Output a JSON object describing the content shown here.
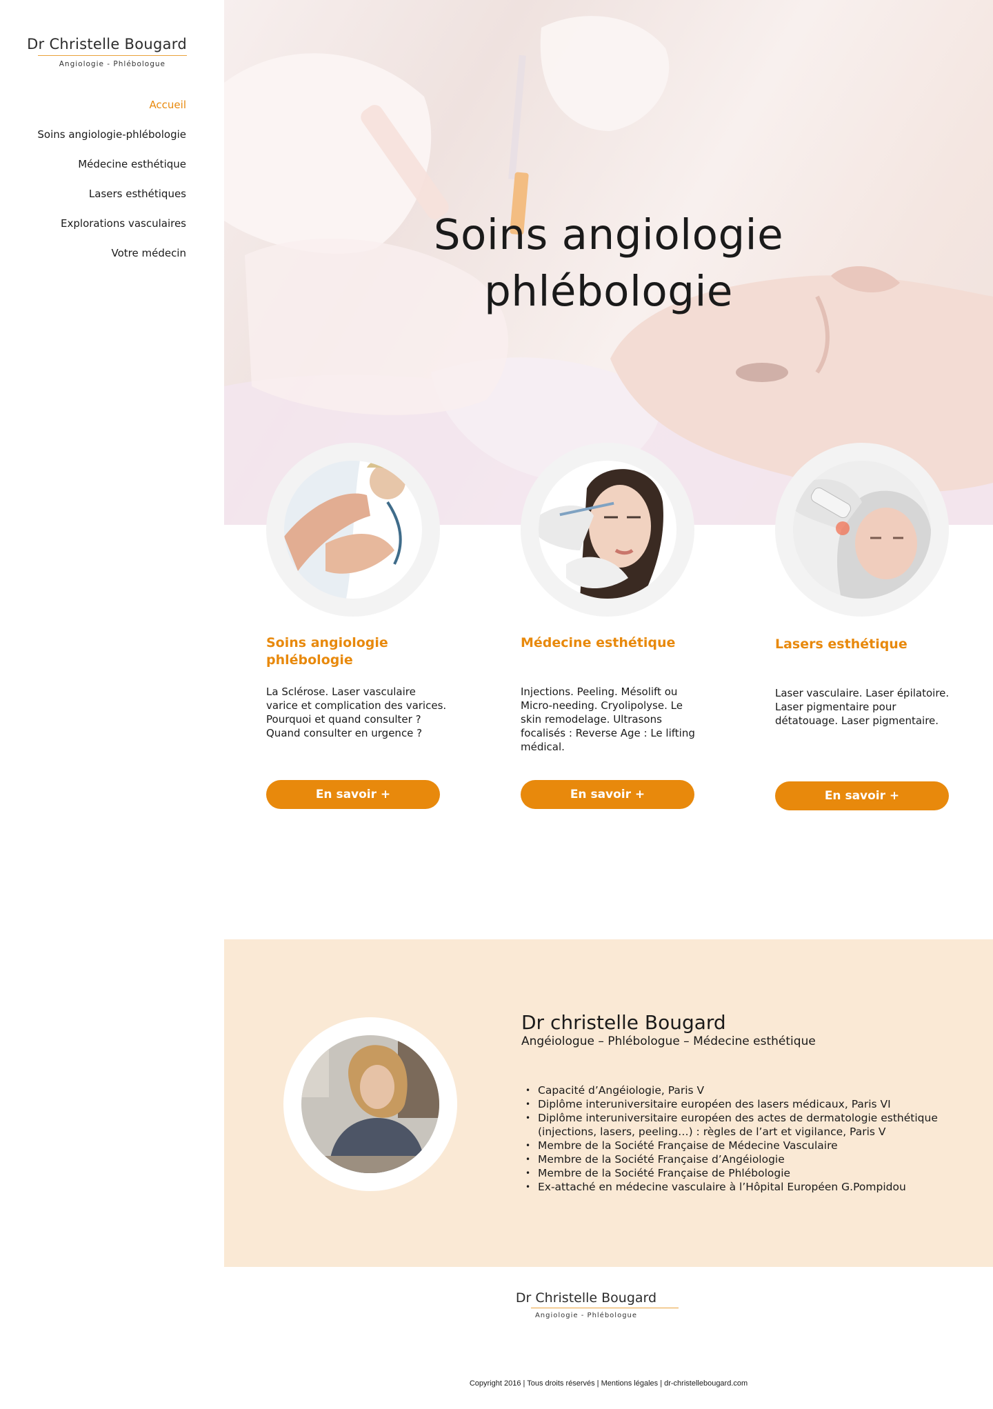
{
  "brand": {
    "name": "Dr Christelle Bougard",
    "tagline": "Angiologie - Phlébologue"
  },
  "nav": [
    {
      "label": "Accueil",
      "active": true
    },
    {
      "label": "Soins angiologie-phlébologie",
      "active": false
    },
    {
      "label": "Médecine esthétique",
      "active": false
    },
    {
      "label": "Lasers esthétiques",
      "active": false
    },
    {
      "label": "Explorations vasculaires",
      "active": false
    },
    {
      "label": "Votre médecin",
      "active": false
    }
  ],
  "hero": {
    "title_line1": "Soins angiologie",
    "title_line2": "phlébologie"
  },
  "cards": [
    {
      "title": "Soins angiologie phlébologie",
      "text": "La Sclérose. Laser vasculaire varice et complication des varices. Pourquoi et quand consulter ? Quand consulter en urgence ?",
      "button": "En savoir +"
    },
    {
      "title": "Médecine esthétique",
      "text": "Injections. Peeling. Mésolift ou Micro-needing. Cryolipolyse. Le skin remodelage. Ultrasons focalisés : Reverse Age : Le lifting médical.",
      "button": "En savoir +"
    },
    {
      "title": "Lasers esthétique",
      "text": "Laser vasculaire. Laser épilatoire. Laser pigmentaire pour détatouage. Laser pigmentaire.",
      "button": "En savoir +"
    }
  ],
  "about": {
    "name": "Dr christelle Bougard",
    "role": "Angéiologue – Phlébologue – Médecine esthétique",
    "credentials": [
      "Capacité d’Angéiologie, Paris V",
      "Diplôme interuniversitaire européen des lasers médicaux, Paris VI",
      "Diplôme interuniversitaire européen des actes de dermatologie esthétique (injections, lasers, peeling…) : règles de l’art et vigilance, Paris V",
      "Membre de la Société Française de Médecine Vasculaire",
      "Membre de la Société Française d’Angéiologie",
      "Membre de la Société Française de Phlébologie",
      "Ex-attaché en médecine vasculaire à l’Hôpital Européen G.Pompidou"
    ]
  },
  "footer": {
    "brand_name": "Dr Christelle Bougard",
    "brand_tagline": "Angiologie - Phlébologue",
    "copyright": "Copyright 2016 | Tous droits réservés | Mentions légales | dr-christellebougard.com"
  },
  "colors": {
    "accent": "#e8890c",
    "about_bg": "#fae9d5",
    "text": "#1a1a1a"
  }
}
